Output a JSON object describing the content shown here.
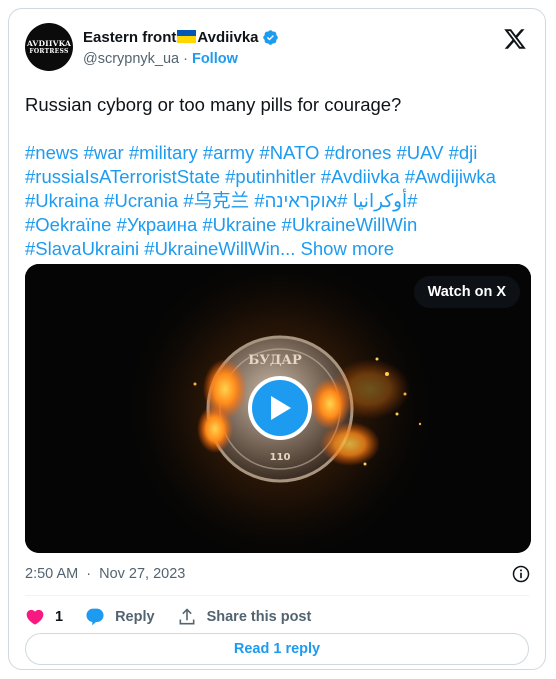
{
  "author": {
    "name": "Eastern front",
    "name_suffix": "Avdiivka",
    "flag_icon": "ukraine-flag",
    "handle": "@scrypnyk_ua",
    "separator": "·",
    "follow_label": "Follow",
    "avatar_line1": "AVDIIVKA",
    "avatar_line2": "FORTRESS"
  },
  "tweet": {
    "text": "Russian cyborg or too many pills for courage?",
    "hashtag_lines": [
      "#news #war #military #army #NATO  #drones #UAV #dji",
      "#russiaIsATerroristState #putinhitler #Avdiivka  #Awdijiwka",
      "#Ukraina #Ucrania #乌克兰 #أوكرانيا #אוקראינה#",
      "#Oekraïne #Украина #Ukraine #UkraineWillWin",
      "#SlavaUkraini  #UkraineWillWin..."
    ],
    "show_more_label": "Show more"
  },
  "media": {
    "watch_label": "Watch on X",
    "coin_text_top": "БУДАР",
    "coin_number": "110"
  },
  "meta": {
    "time": "2:50 AM",
    "separator": "·",
    "date": "Nov 27, 2023"
  },
  "actions": {
    "like_count": "1",
    "reply_label": "Reply",
    "share_label": "Share this post"
  },
  "read_replies_label": "Read 1 reply",
  "colors": {
    "accent": "#1d9bf0",
    "like": "#f91880",
    "text": "#0f1419",
    "muted": "#536471"
  }
}
